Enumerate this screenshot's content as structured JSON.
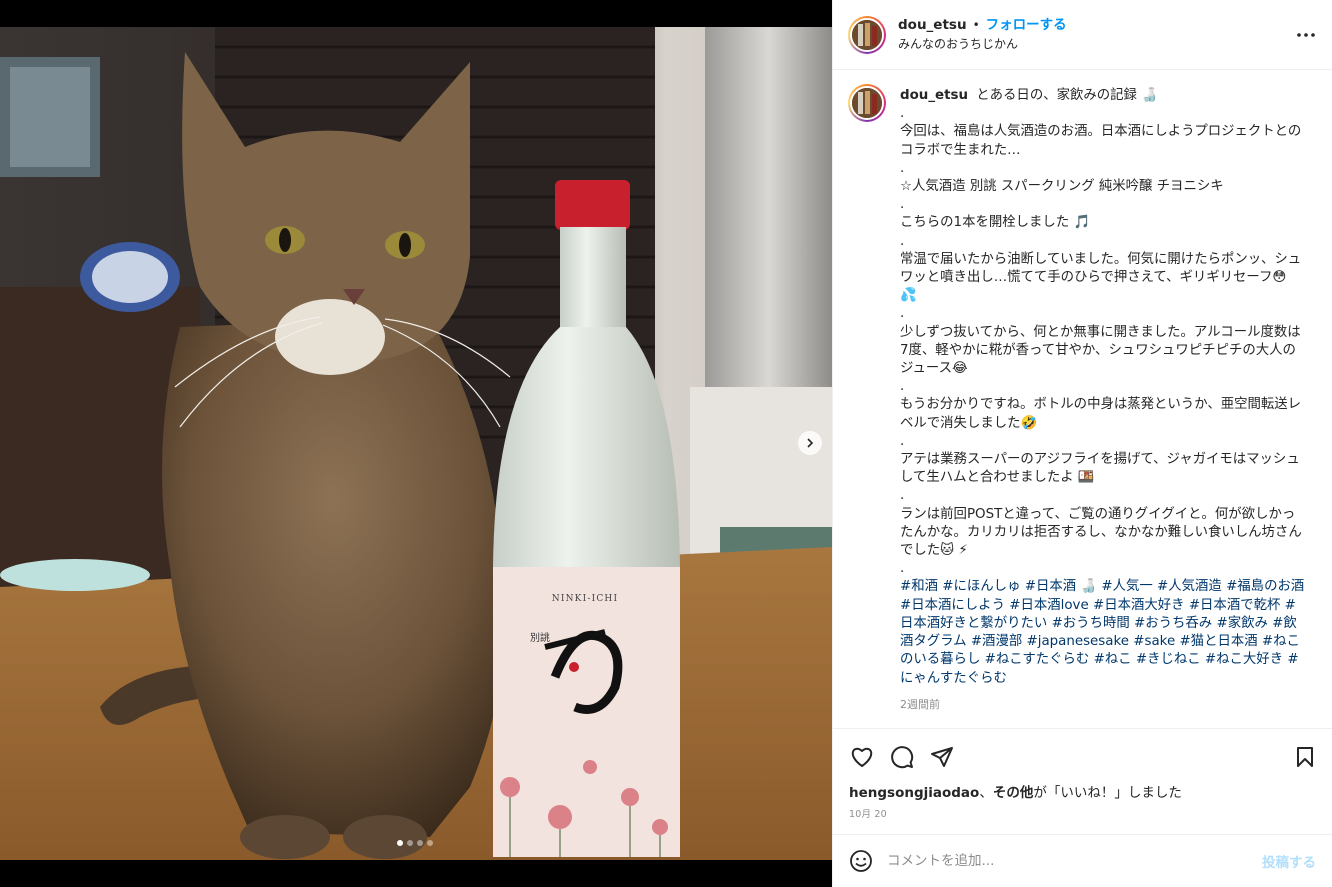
{
  "post": {
    "username": "dou_etsu",
    "separator": "•",
    "follow_label": "フォローする",
    "location": "みんなのおうちじかん",
    "more_icon": "more-horizontal-icon"
  },
  "media": {
    "carousel_count": 4,
    "carousel_active": 1,
    "next_icon": "chevron-right-icon",
    "bottle_label": "NINKI-ICHI",
    "bottle_name_small": "別誂"
  },
  "caption": {
    "username": "dou_etsu",
    "first_line": "とある日の、家飲みの記録 🍶",
    "paragraphs": [
      ".\n今回は、福島は人気酒造のお酒。日本酒にしようプロジェクトとのコラボで生まれた…",
      ".\n☆人気酒造 別誂 スパークリング 純米吟醸 チヨニシキ",
      ".\nこちらの1本を開栓しました 🎵",
      ".\n常温で届いたから油断していました。何気に開けたらポンッ、シュワッと噴き出し…慌てて手のひらで押さえて、ギリギリセーフ😳 💦",
      ".\n少しずつ抜いてから、何とか無事に開きました。アルコール度数は7度、軽やかに糀が香って甘やか、シュワシュワピチピチの大人のジュース😂",
      ".\nもうお分かりですね。ボトルの中身は蒸発というか、亜空間転送レベルで消失しました🤣",
      ".\nアテは業務スーパーのアジフライを揚げて、ジャガイモはマッシュして生ハムと合わせましたよ 🍱",
      ".\nランは前回POSTと違って、ご覧の通りグイグイと。何が欲しかったんかな。カリカリは拒否するし、なかなか難しい食いしん坊さんでした🐱 ⚡",
      "."
    ],
    "hashtags": [
      "#和酒",
      "#にほんしゅ",
      "#日本酒 🍶",
      "#人気一",
      "#人気酒造",
      "#福島のお酒",
      "#日本酒にしよう",
      "#日本酒love",
      "#日本酒大好き",
      "#日本酒で乾杯",
      "#日本酒好きと繋がりたい",
      "#おうち時間",
      "#おうち呑み",
      "#家飲み",
      "#飲酒タグラム",
      "#酒漫部",
      "#japanesesake",
      "#sake",
      "#猫と日本酒",
      "#ねこのいる暮らし",
      "#ねこすたぐらむ",
      "#ねこ",
      "#きじねこ",
      "#ねこ大好き",
      "#にゃんすたぐらむ"
    ],
    "time_ago": "2週間前"
  },
  "actions": {
    "like_icon": "heart-icon",
    "comment_icon": "comment-icon",
    "share_icon": "share-icon",
    "save_icon": "bookmark-icon"
  },
  "likes": {
    "user": "hengsongjiaodao",
    "sep": "、",
    "others": "その他",
    "suffix": "が「いいね！」しました"
  },
  "date": "10月 20",
  "comment": {
    "placeholder": "コメントを追加...",
    "post_label": "投稿する",
    "emoji_icon": "smile-icon"
  },
  "colors": {
    "accent": "#0095f6",
    "hashtag": "#00376b",
    "muted": "#8e8e8e",
    "post_disabled": "#b2dffc"
  }
}
